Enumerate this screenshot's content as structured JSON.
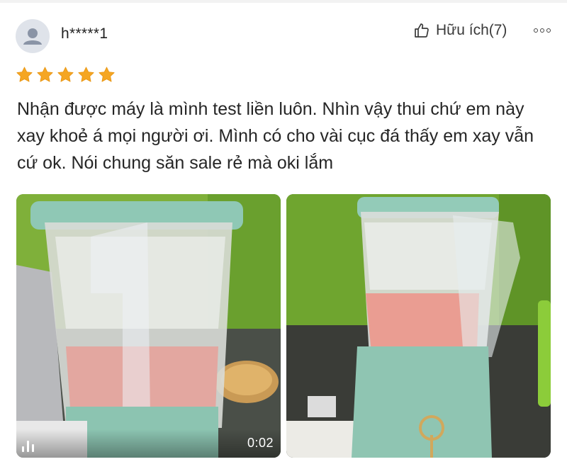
{
  "review": {
    "username": "h*****1",
    "helpful_label": "Hữu ích(7)",
    "rating": 5,
    "rating_max": 5,
    "text": "Nhận được máy là mình test liền luôn. Nhìn vậy thui chứ em này xay khoẻ á mọi người ơi. Mình có cho vài cục đá thấy em xay vẫn cứ ok. Nói chung săn sale rẻ mà oki lắm",
    "colors": {
      "star": "#f5a623",
      "avatar_bg": "#dfe3ea",
      "avatar_fg": "#8a94a6"
    },
    "icons": {
      "helpful": "thumbs-up-icon",
      "more": "more-options-icon",
      "video": "video-icon"
    },
    "media": [
      {
        "type": "video",
        "duration": "0:02"
      },
      {
        "type": "image"
      }
    ]
  }
}
